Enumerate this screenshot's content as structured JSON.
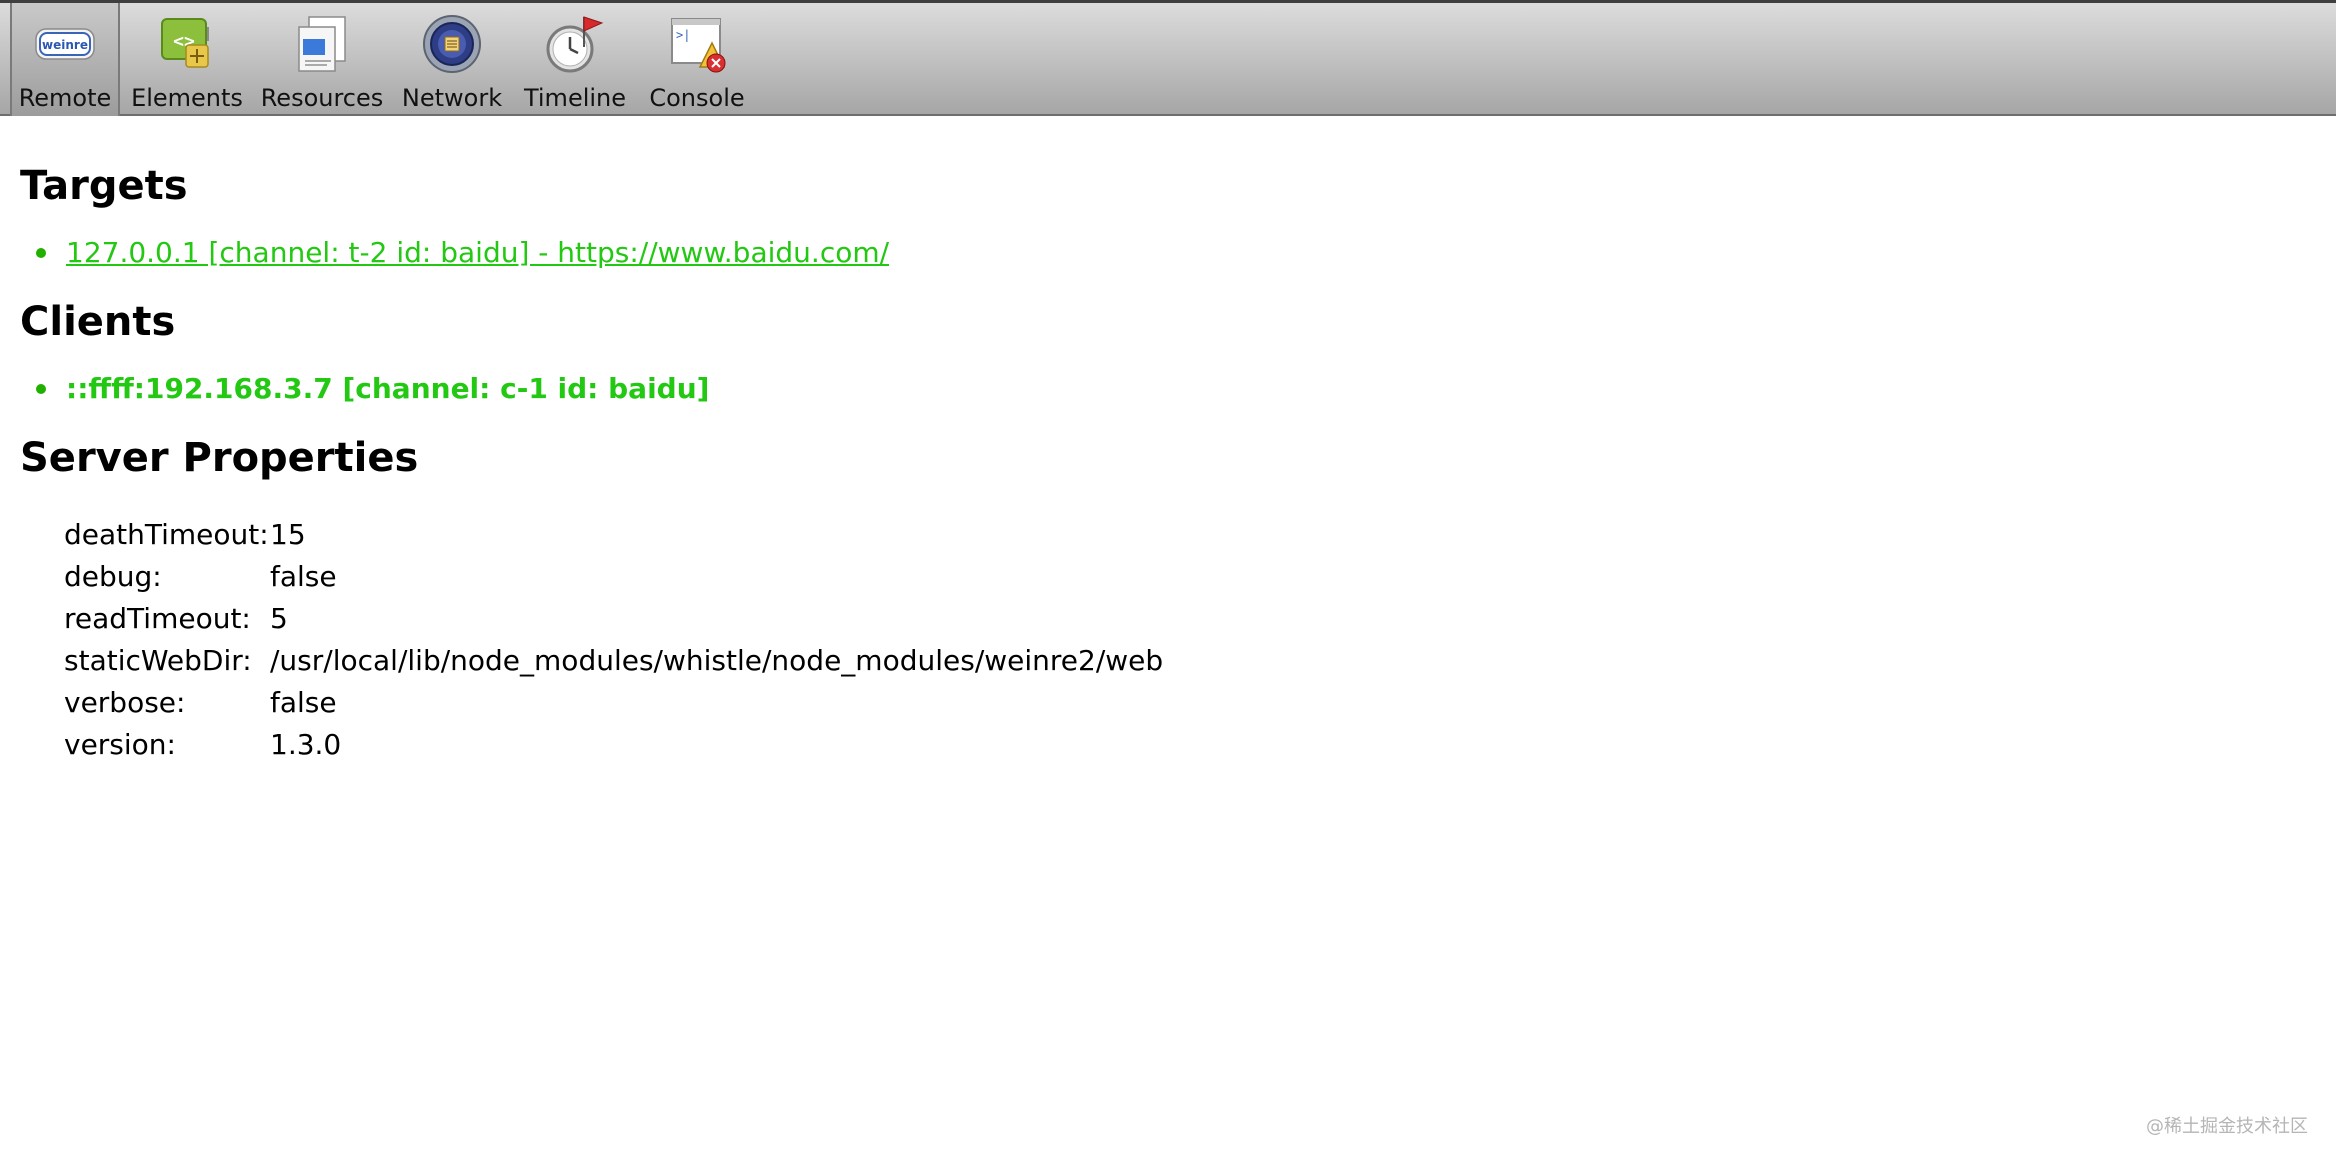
{
  "toolbar": {
    "tabs": [
      {
        "label": "Remote",
        "icon": "weinre-logo-icon",
        "selected": true
      },
      {
        "label": "Elements",
        "icon": "elements-icon",
        "selected": false
      },
      {
        "label": "Resources",
        "icon": "resources-icon",
        "selected": false
      },
      {
        "label": "Network",
        "icon": "network-icon",
        "selected": false
      },
      {
        "label": "Timeline",
        "icon": "timeline-icon",
        "selected": false
      },
      {
        "label": "Console",
        "icon": "console-icon",
        "selected": false
      }
    ],
    "logo_text": "weinre"
  },
  "sections": {
    "targets": {
      "title": "Targets",
      "items": [
        "127.0.0.1 [channel: t-2 id: baidu] - https://www.baidu.com/"
      ]
    },
    "clients": {
      "title": "Clients",
      "items": [
        "::ffff:192.168.3.7 [channel: c-1 id: baidu]"
      ]
    },
    "server_properties": {
      "title": "Server Properties",
      "rows": [
        {
          "key": "deathTimeout:",
          "value": "15"
        },
        {
          "key": "debug:",
          "value": "false"
        },
        {
          "key": "readTimeout:",
          "value": "5"
        },
        {
          "key": "staticWebDir:",
          "value": "/usr/local/lib/node_modules/whistle/node_modules/weinre2/web"
        },
        {
          "key": "verbose:",
          "value": "false"
        },
        {
          "key": "version:",
          "value": "1.3.0"
        }
      ]
    }
  },
  "watermark": "@稀土掘金技术社区",
  "colors": {
    "link_green": "#23c812",
    "toolbar_top": "#dcdcdc",
    "toolbar_bottom": "#a6a6a6"
  }
}
